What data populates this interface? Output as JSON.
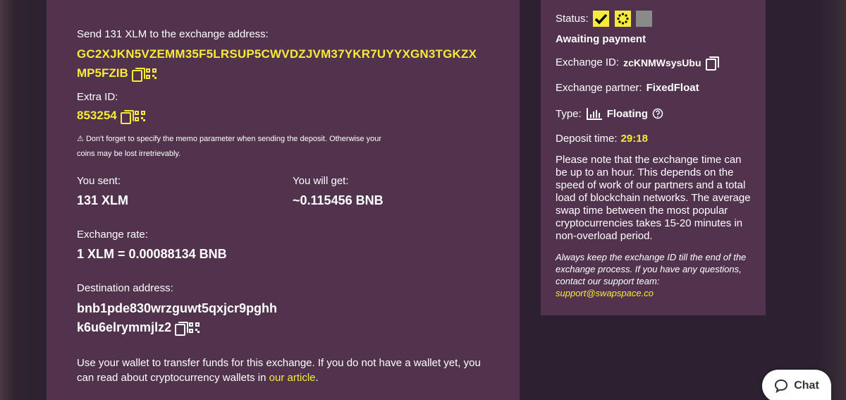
{
  "send": {
    "instruction": "Send 131 XLM to the exchange address:",
    "address_line1": "GC2XJKN5VZEMM35F5LRSUP5CWVDZJVM37YKR7UYYXGN3TGKZX",
    "address_line2": "MP5FZIB",
    "extra_id_label": "Extra ID:",
    "extra_id": "853254",
    "warning_line1": "Don't forget to specify the memo parameter when sending the deposit. Otherwise your",
    "warning_line2": "coins may be lost irretrievably."
  },
  "amounts": {
    "sent_label": "You sent:",
    "sent_value": "131 XLM",
    "get_label": "You will get:",
    "get_value": "~0.115456 BNB"
  },
  "rate": {
    "label": "Exchange rate:",
    "value": "1 XLM = 0.00088134 BNB"
  },
  "destination": {
    "label": "Destination address:",
    "line1": "bnb1pde830wrzguwt5qxjcr9pghh",
    "line2": "k6u6elrymmjlz2"
  },
  "wallet_note": {
    "line1": "Use your wallet to transfer funds for this exchange. If you do not have a wallet yet, you",
    "line2_prefix": "can read about cryptocurrency wallets in ",
    "link": "our article",
    "line2_suffix": "."
  },
  "side": {
    "status_label": "Status:",
    "status_text": "Awaiting payment",
    "exchange_id_label": "Exchange ID:",
    "exchange_id": "zcKNMWsysUbu",
    "partner_label": "Exchange partner:",
    "partner": "FixedFloat",
    "type_label": "Type:",
    "type_value": "Floating",
    "deposit_label": "Deposit time:",
    "deposit_time": "29:18",
    "note_lines": [
      "Please note that the exchange time can",
      "be up to an hour. This depends on the",
      "speed of work of our partners and a total",
      "load of blockchain networks. The average",
      "swap time between the most popular",
      "cryptocurrencies takes 15-20 minutes in",
      "non-overload period."
    ],
    "keep_lines": [
      "Always keep the exchange ID till the end of the",
      "exchange process. If you have any questions,",
      "contact our support team:"
    ],
    "support_email": "support@swapspace.co"
  },
  "chat": {
    "label": "Chat"
  },
  "colors": {
    "accent": "#f6ea3a",
    "card": "#52334d",
    "background": "#2b2130"
  },
  "icons": [
    "copy-icon",
    "qr-code-icon",
    "warning-icon",
    "bar-chart-icon",
    "help-circle-icon",
    "chat-bubble-icon",
    "check-icon",
    "loading-icon"
  ]
}
